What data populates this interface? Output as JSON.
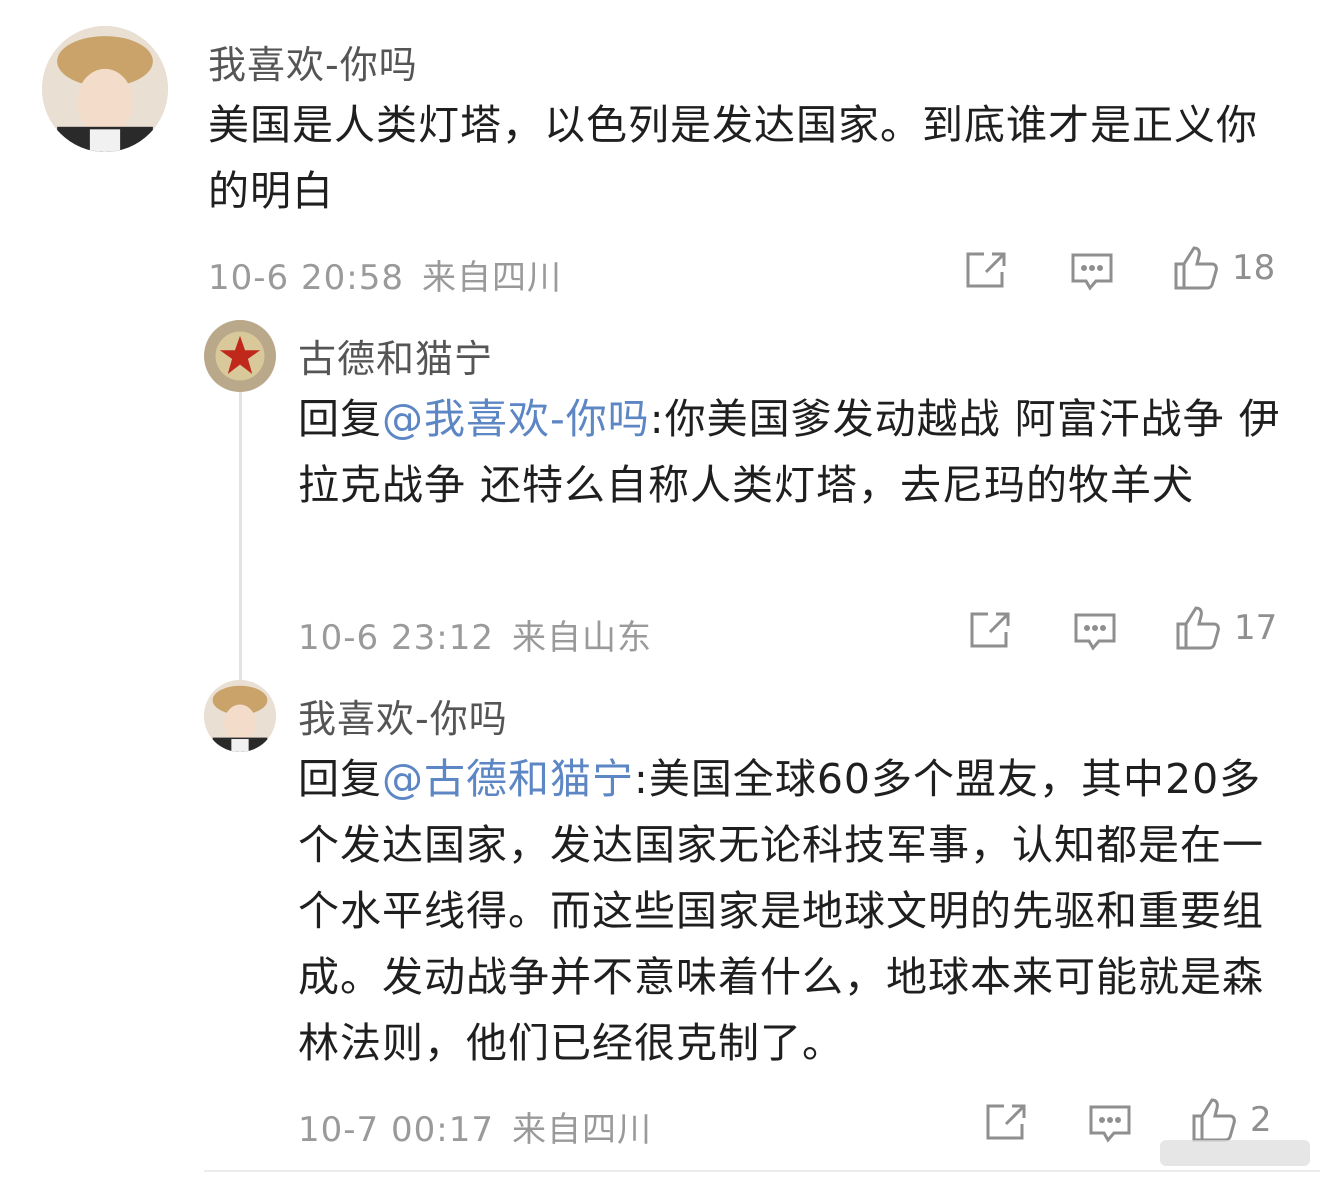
{
  "comments": [
    {
      "username": "我喜欢-你吗",
      "text": "美国是人类灯塔，以色列是发达国家。到底谁才是正义你的明白",
      "date": "10-6 20:58",
      "location": "来自四川",
      "likes": "18"
    },
    {
      "username": "古德和猫宁",
      "reply_prefix": "回复",
      "reply_to": "@我喜欢-你吗",
      "text": ":你美国爹发动越战 阿富汗战争 伊拉克战争 还特么自称人类灯塔，去尼玛的牧羊犬",
      "date": "10-6 23:12",
      "location": "来自山东",
      "likes": "17"
    },
    {
      "username": "我喜欢-你吗",
      "reply_prefix": "回复",
      "reply_to": "@古德和猫宁",
      "text": ":美国全球60多个盟友，其中20多个发达国家，发达国家无论科技军事，认知都是在一个水平线得。而这些国家是地球文明的先驱和重要组成。发动战争并不意味着什么，地球本来可能就是森林法则，他们已经很克制了。",
      "date": "10-7 00:17",
      "location": "来自四川",
      "likes": "2"
    }
  ],
  "icons": {
    "share": "share-icon",
    "comment": "comment-icon",
    "like": "thumbs-up-icon"
  },
  "colors": {
    "mention": "#5c86c4",
    "meta": "#9a9a9a",
    "text": "#1f1f1f"
  }
}
